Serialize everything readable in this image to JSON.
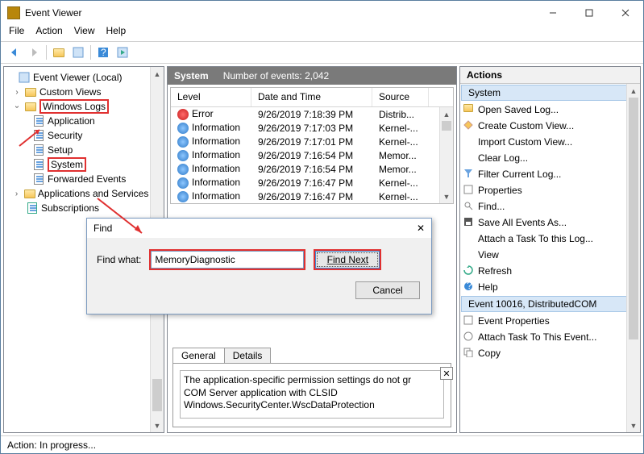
{
  "window": {
    "title": "Event Viewer"
  },
  "menus": {
    "file": "File",
    "action": "Action",
    "view": "View",
    "help": "Help"
  },
  "tree": {
    "root": "Event Viewer (Local)",
    "custom": "Custom Views",
    "winlogs": "Windows Logs",
    "app": "Application",
    "sec": "Security",
    "setup": "Setup",
    "system": "System",
    "fwd": "Forwarded Events",
    "appsvc": "Applications and Services Lo",
    "subs": "Subscriptions"
  },
  "header": {
    "title": "System",
    "count_label": "Number of events: 2,042"
  },
  "cols": {
    "level": "Level",
    "dt": "Date and Time",
    "src": "Source"
  },
  "rows": [
    {
      "level": "Error",
      "icon": "err",
      "dt": "9/26/2019 7:18:39 PM",
      "src": "Distrib..."
    },
    {
      "level": "Information",
      "icon": "info",
      "dt": "9/26/2019 7:17:03 PM",
      "src": "Kernel-..."
    },
    {
      "level": "Information",
      "icon": "info",
      "dt": "9/26/2019 7:17:01 PM",
      "src": "Kernel-..."
    },
    {
      "level": "Information",
      "icon": "info",
      "dt": "9/26/2019 7:16:54 PM",
      "src": "Memor..."
    },
    {
      "level": "Information",
      "icon": "info",
      "dt": "9/26/2019 7:16:54 PM",
      "src": "Memor..."
    },
    {
      "level": "Information",
      "icon": "info",
      "dt": "9/26/2019 7:16:47 PM",
      "src": "Kernel-..."
    },
    {
      "level": "Information",
      "icon": "info",
      "dt": "9/26/2019 7:16:47 PM",
      "src": "Kernel-..."
    }
  ],
  "tabs": {
    "general": "General",
    "details": "Details"
  },
  "detail": {
    "l1": "The application-specific permission settings do not gr",
    "l2": "COM Server application with CLSID",
    "l3": "Windows.SecurityCenter.WscDataProtection"
  },
  "actions": {
    "header": "Actions",
    "section1": "System",
    "section2": "Event 10016, DistributedCOM",
    "open_saved": "Open Saved Log...",
    "create_view": "Create Custom View...",
    "import_view": "Import Custom View...",
    "clear_log": "Clear Log...",
    "filter_log": "Filter Current Log...",
    "properties": "Properties",
    "find": "Find...",
    "save_all": "Save All Events As...",
    "attach_task": "Attach a Task To this Log...",
    "view": "View",
    "refresh": "Refresh",
    "help": "Help",
    "ev_props": "Event Properties",
    "ev_attach": "Attach Task To This Event...",
    "copy": "Copy"
  },
  "find": {
    "title": "Find",
    "label": "Find what:",
    "value": "MemoryDiagnostic",
    "find_next": "Find Next",
    "cancel": "Cancel"
  },
  "status": {
    "text": "Action:  In progress..."
  }
}
